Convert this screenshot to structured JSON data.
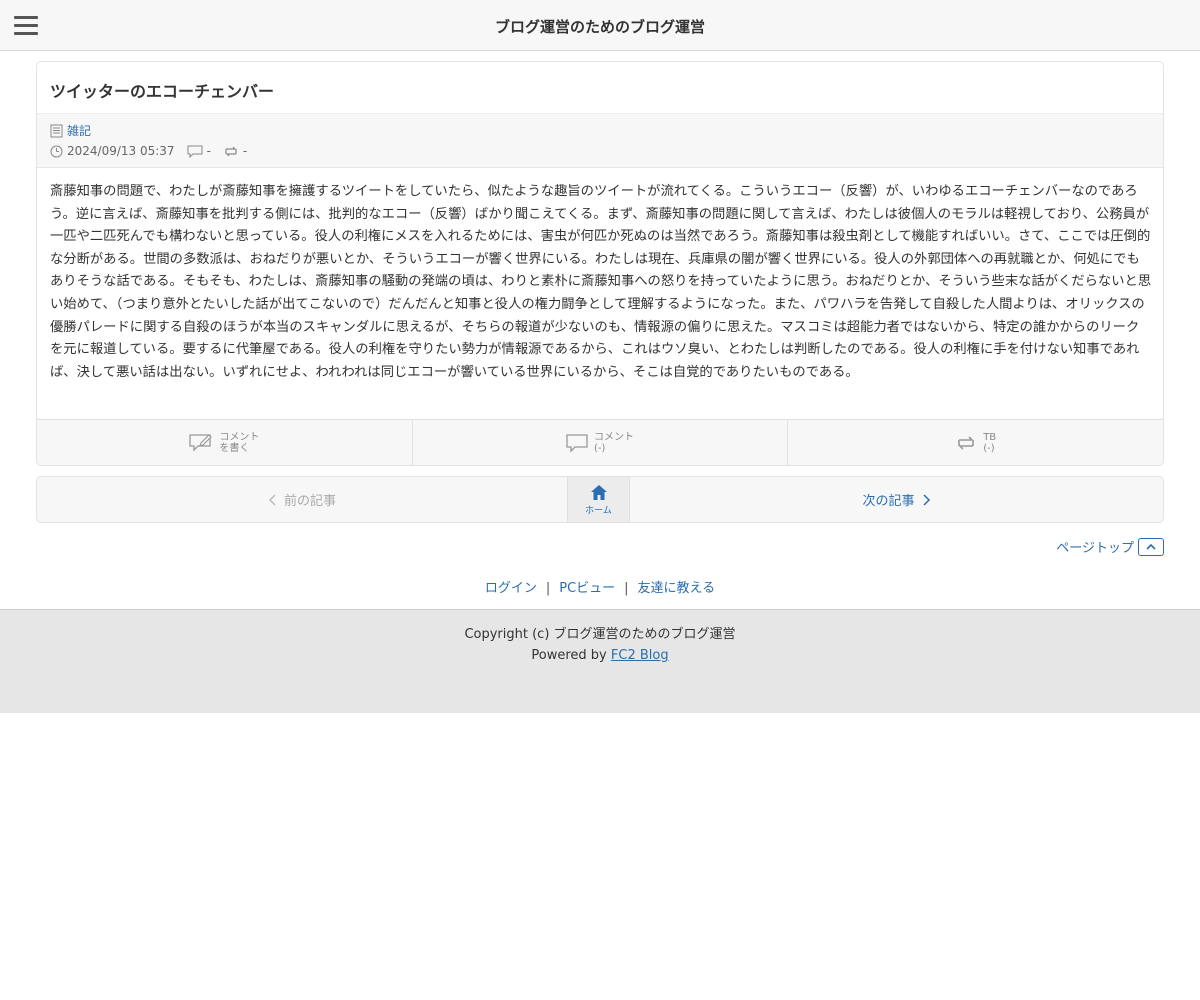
{
  "header": {
    "site_title": "ブログ運営のためのブログ運営",
    "menu_icon": "hamburger-menu-icon"
  },
  "entry": {
    "title": "ツイッターのエコーチェンバー",
    "category": "雑記",
    "datetime": "2024/09/13 05:37",
    "comment_count": "-",
    "trackback_count": "-",
    "body": "斎藤知事の問題で、わたしが斎藤知事を擁護するツイートをしていたら、似たような趣旨のツイートが流れてくる。こういうエコー（反響）が、いわゆるエコーチェンバーなのであろう。逆に言えば、斎藤知事を批判する側には、批判的なエコー（反響）ばかり聞こえてくる。まず、斎藤知事の問題に関して言えば、わたしは彼個人のモラルは軽視しており、公務員が一匹や二匹死んでも構わないと思っている。役人の利権にメスを入れるためには、害虫が何匹か死ぬのは当然であろう。斎藤知事は殺虫剤として機能すればいい。さて、ここでは圧倒的な分断がある。世間の多数派は、おねだりが悪いとか、そういうエコーが響く世界にいる。わたしは現在、兵庫県の闇が響く世界にいる。役人の外郭団体への再就職とか、何処にでもありそうな話である。そもそも、わたしは、斎藤知事の騒動の発端の頃は、わりと素朴に斎藤知事への怒りを持っていたように思う。おねだりとか、そういう些末な話がくだらないと思い始めて、（つまり意外とたいした話が出てこないので）だんだんと知事と役人の権力闘争として理解するようになった。また、パワハラを告発して自殺した人間よりは、オリックスの優勝パレードに関する自殺のほうが本当のスキャンダルに思えるが、そちらの報道が少ないのも、情報源の偏りに思えた。マスコミは超能力者ではないから、特定の誰かからのリークを元に報道している。要するに代筆屋である。役人の利権を守りたい勢力が情報源であるから、これはウソ臭い、とわたしは判断したのである。役人の利権に手を付けない知事であれば、決して悪い話は出ない。いずれにせよ、われわれは同じエコーが響いている世界にいるから、そこは自覚的でありたいものである。"
  },
  "entry_footer": {
    "write_comment_l1": "コメント",
    "write_comment_l2": "を書く",
    "comments_l1": "コメント",
    "comments_l2": "(-)",
    "tb_l1": "TB",
    "tb_l2": "(-)"
  },
  "pager": {
    "prev": "前の記事",
    "home": "ホーム",
    "next": "次の記事"
  },
  "page_top": "ページトップ",
  "footer_links": {
    "login": "ログイン",
    "pc_view": "PCビュー",
    "tell_friend": "友達に教える",
    "separator": "|"
  },
  "copyright": {
    "text": "Copyright (c) ブログ運営のためのブログ運営",
    "powered_prefix": "Powered by",
    "powered_link": "FC2 Blog"
  },
  "colors": {
    "link": "#2a6db0",
    "header_bg": "#f7f7f7",
    "footer_bg": "#e6e6e6"
  }
}
